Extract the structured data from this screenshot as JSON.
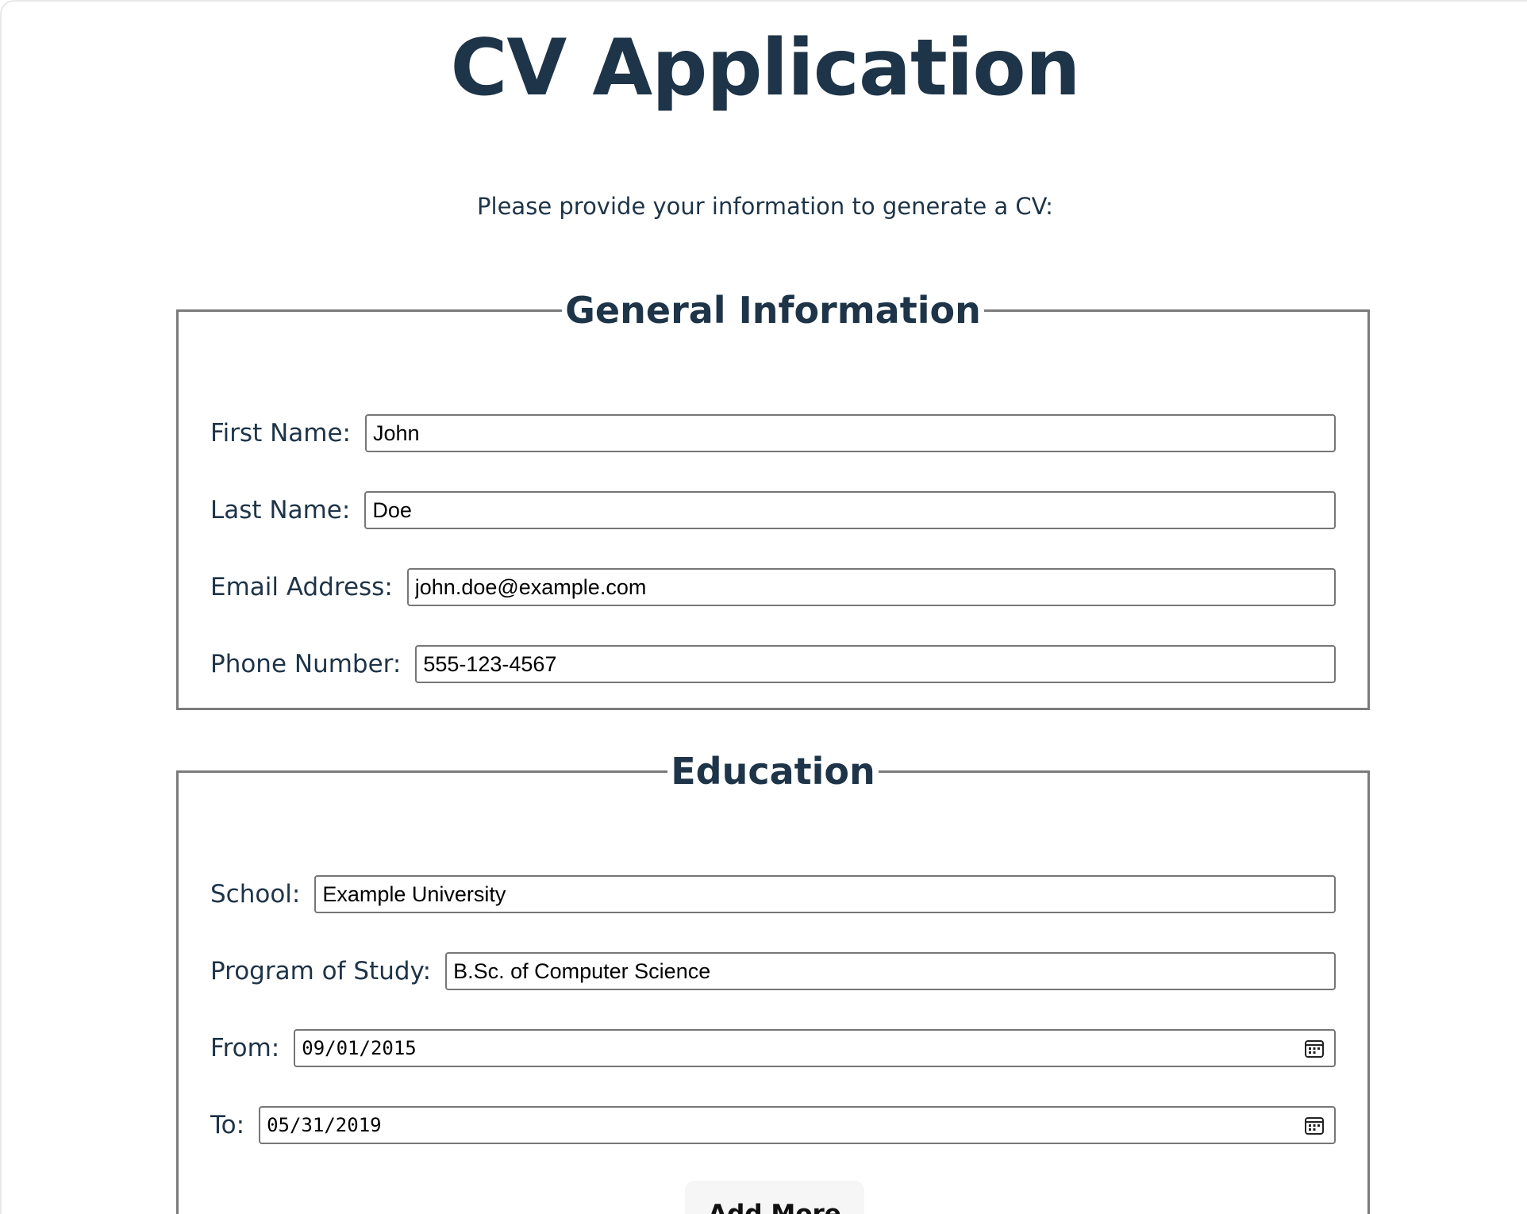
{
  "header": {
    "title": "CV Application",
    "intro": "Please provide your information to generate a CV:"
  },
  "general": {
    "legend": "General Information",
    "first_name": {
      "label": "First Name:",
      "value": "John"
    },
    "last_name": {
      "label": "Last Name:",
      "value": "Doe"
    },
    "email": {
      "label": "Email Address:",
      "value": "john.doe@example.com"
    },
    "phone": {
      "label": "Phone Number:",
      "value": "555-123-4567"
    }
  },
  "education": {
    "legend": "Education",
    "school": {
      "label": "School:",
      "value": "Example University"
    },
    "program": {
      "label": "Program of Study:",
      "value": "B.Sc. of Computer Science"
    },
    "from": {
      "label": "From:",
      "value": "09/01/2015",
      "icon": "calendar-icon"
    },
    "to": {
      "label": "To:",
      "value": "05/31/2019",
      "icon": "calendar-icon"
    },
    "add_more_label": "Add More"
  },
  "colors": {
    "text": "#1e3448",
    "border": "#7b7b7b",
    "button_bg": "#f6f6f6"
  }
}
